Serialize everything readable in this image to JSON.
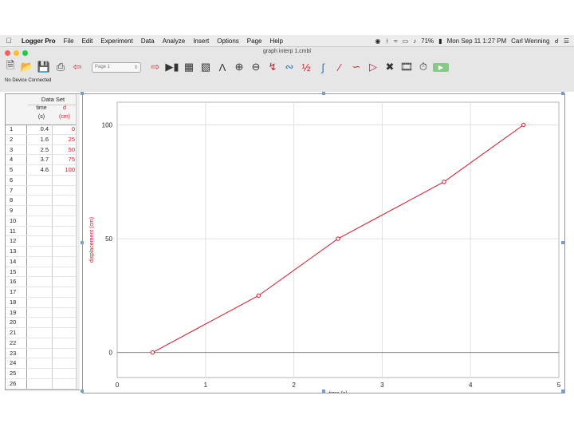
{
  "menubar": {
    "app_name": "Logger Pro",
    "items": [
      "File",
      "Edit",
      "Experiment",
      "Data",
      "Analyze",
      "Insert",
      "Options",
      "Page",
      "Help"
    ],
    "battery": "71%",
    "datetime": "Mon Sep 11  1:27 PM",
    "user": "Carl Wenning"
  },
  "window": {
    "title": "graph interp 1.cmbl",
    "page_selector": "Page 1",
    "status": "No Device Connected"
  },
  "colors": {
    "accent": "#d0182b",
    "grid": "#e0e0e0"
  },
  "data_table": {
    "name": "Data Set",
    "columns": [
      {
        "name": "time",
        "unit": "(s)"
      },
      {
        "name": "d",
        "unit": "(cm)"
      }
    ],
    "row_numbers": [
      "1",
      "2",
      "3",
      "4",
      "5",
      "6",
      "7",
      "8",
      "9",
      "10",
      "11",
      "12",
      "13",
      "14",
      "15",
      "16",
      "17",
      "18",
      "19",
      "20",
      "21",
      "22",
      "23",
      "24",
      "25",
      "26"
    ],
    "rows": [
      [
        "0.4",
        "0"
      ],
      [
        "1.6",
        "25"
      ],
      [
        "2.5",
        "50"
      ],
      [
        "3.7",
        "75"
      ],
      [
        "4.6",
        "100"
      ]
    ]
  },
  "chart_data": {
    "type": "line",
    "x": [
      0.4,
      1.6,
      2.5,
      3.7,
      4.6
    ],
    "series": [
      {
        "values": [
          0,
          25,
          50,
          75,
          100
        ]
      }
    ],
    "xlabel": "time (s)",
    "ylabel": "displacement (cm)",
    "xlim": [
      0,
      5
    ],
    "ylim": [
      -11,
      110
    ],
    "xticks": [
      "0",
      "1",
      "2",
      "3",
      "4",
      "5"
    ],
    "yticks": [
      "0",
      "50",
      "100"
    ],
    "grid": true,
    "marker": "circle"
  }
}
